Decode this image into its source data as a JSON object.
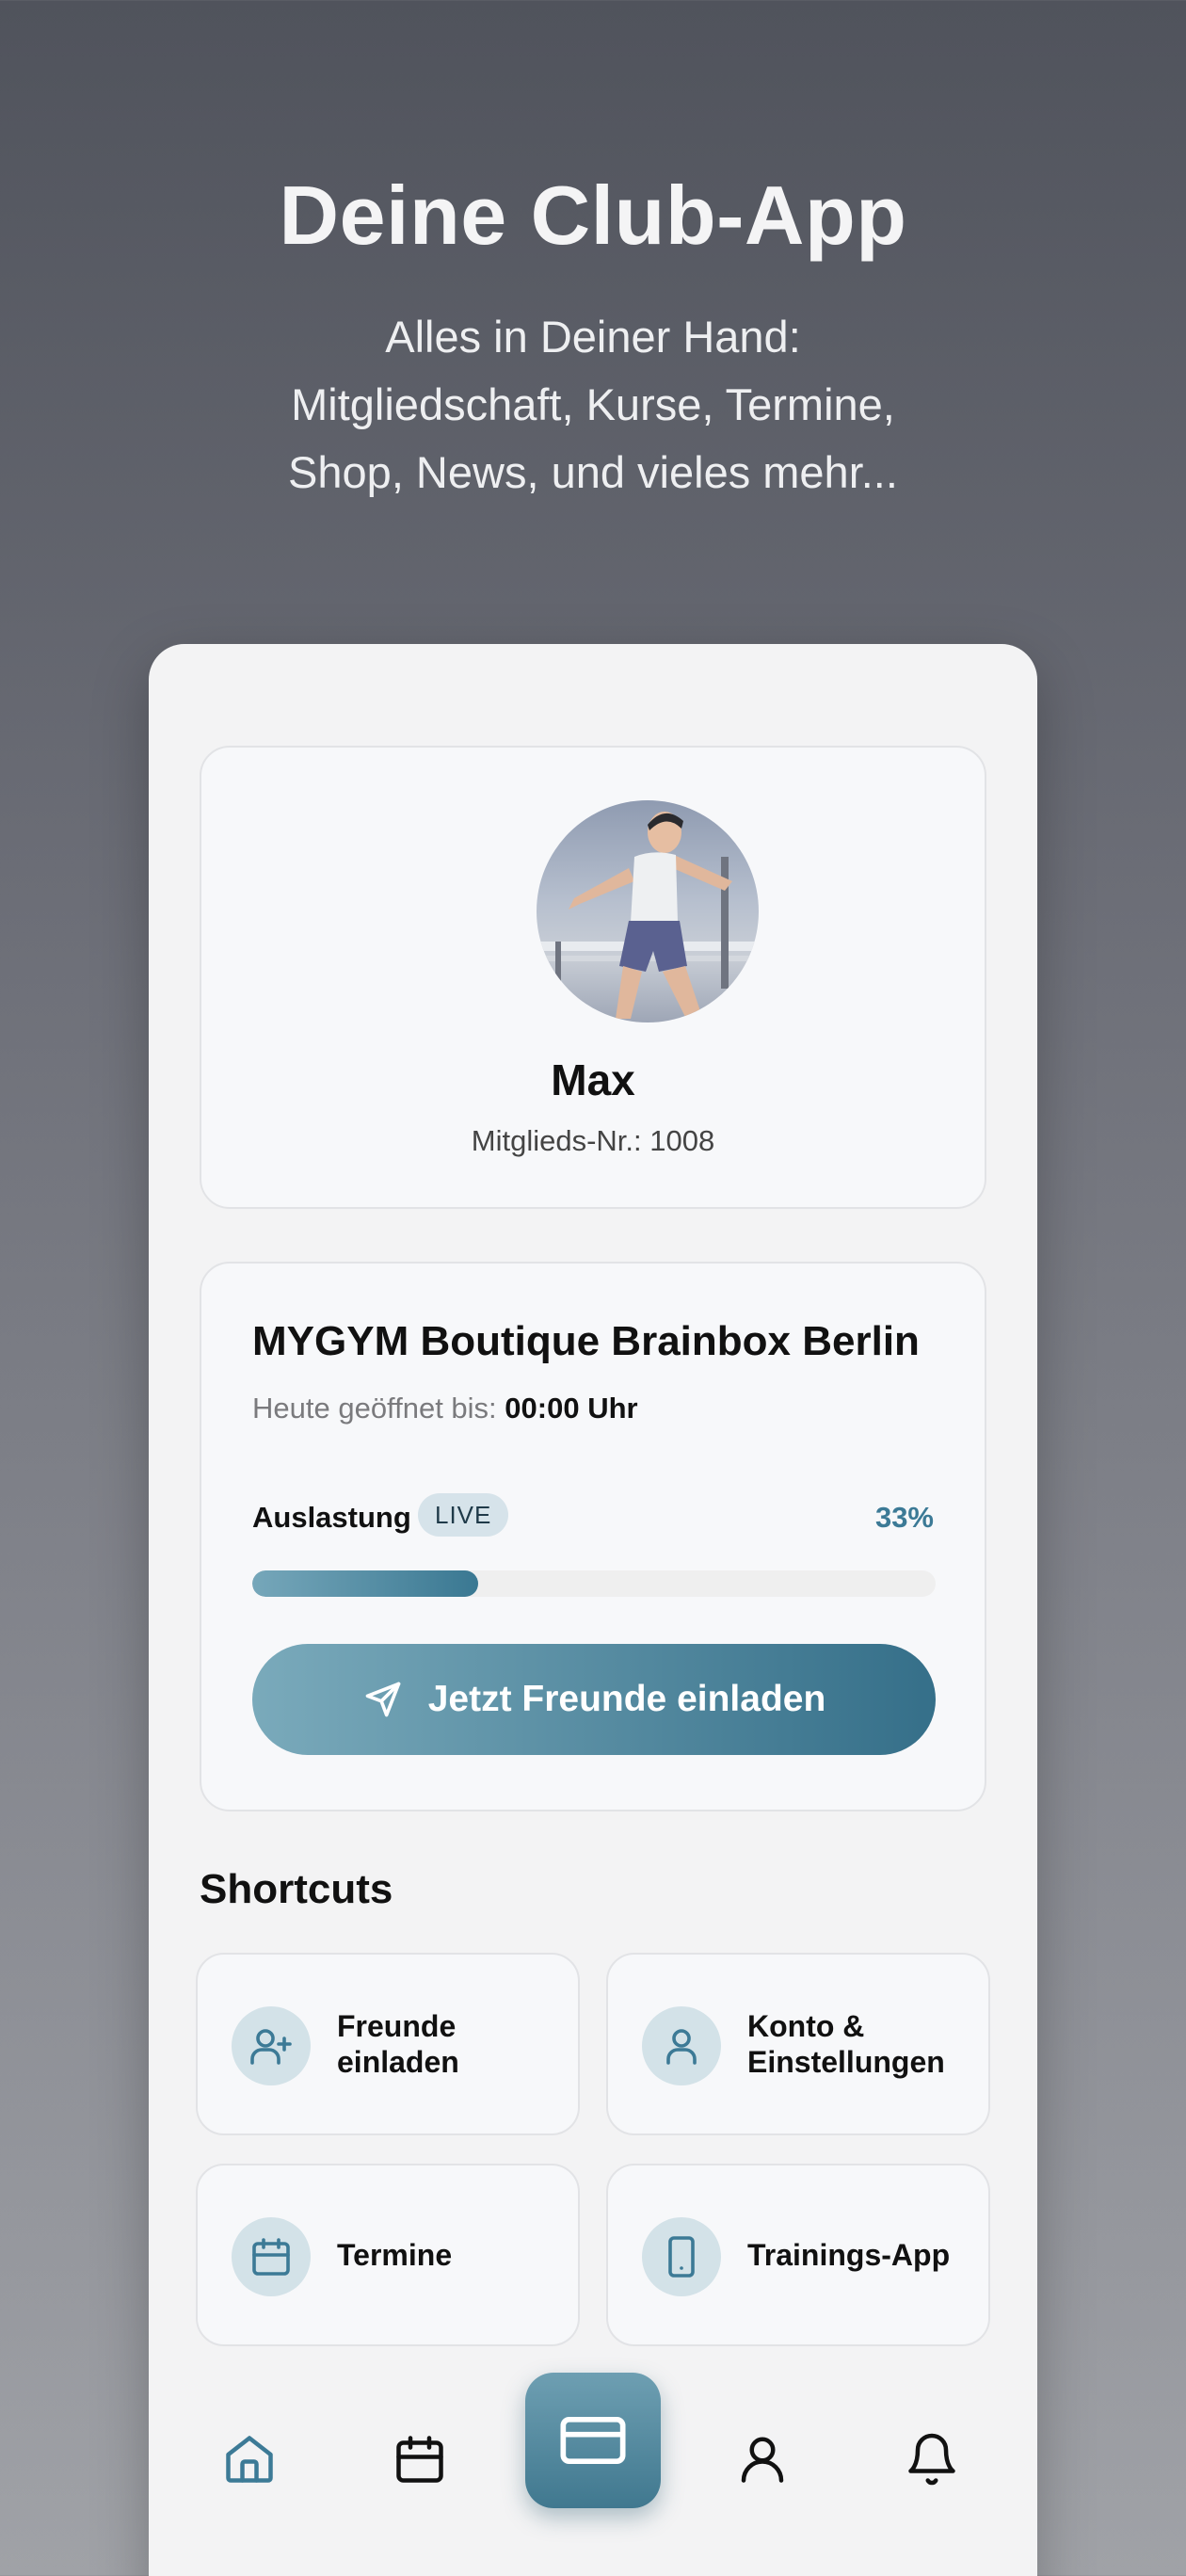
{
  "hero": {
    "title": "Deine Club-App",
    "subtitle_line1": "Alles in Deiner Hand:",
    "subtitle_line2": "Mitgliedschaft, Kurse, Termine,",
    "subtitle_line3": "Shop, News, und vieles mehr..."
  },
  "profile": {
    "name": "Max",
    "member_number": "Mitglieds-Nr.: 1008"
  },
  "gym": {
    "name": "MYGYM Boutique Brainbox Berlin",
    "open_label": "Heute geöffnet bis:",
    "open_until": "00:00 Uhr",
    "utilization_label": "Auslastung",
    "live_badge": "LIVE",
    "utilization_percent_text": "33%",
    "utilization_fraction": 0.33,
    "invite_button": "Jetzt Freunde einladen"
  },
  "shortcuts": {
    "title": "Shortcuts",
    "items": [
      {
        "line1": "Freunde",
        "line2": "einladen",
        "icon": "user-plus-icon"
      },
      {
        "line1": "Konto &",
        "line2": "Einstellungen",
        "icon": "user-icon"
      },
      {
        "line1": "Termine",
        "line2": "",
        "icon": "calendar-icon"
      },
      {
        "line1": "Trainings-App",
        "line2": "",
        "icon": "tablet-icon"
      }
    ]
  },
  "nav": {
    "items": [
      "home-icon",
      "calendar-icon",
      "card-icon",
      "user-icon",
      "bell-icon"
    ],
    "active": "home-icon"
  },
  "colors": {
    "accent": "#3c7a96",
    "accent_light": "#d3e2e8",
    "card_bg": "#f7f8fa"
  }
}
